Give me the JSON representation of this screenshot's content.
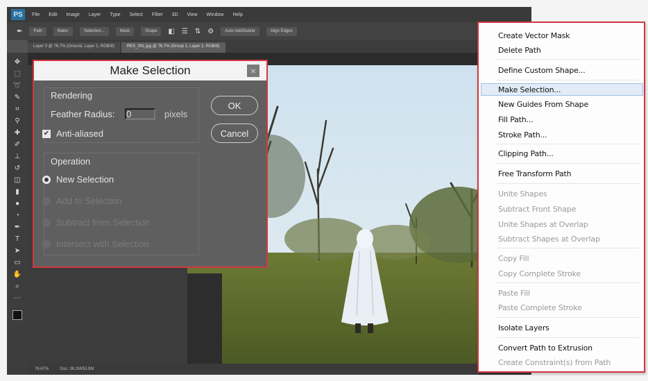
{
  "app": {
    "logo": "PS",
    "menus": [
      "File",
      "Edit",
      "Image",
      "Layer",
      "Type",
      "Select",
      "Filter",
      "3D",
      "View",
      "Window",
      "Help"
    ],
    "options": [
      "Path",
      "Make:",
      "Selection...",
      "Mask",
      "Shape",
      "Auto Add/Delete",
      "Align Edges"
    ],
    "tabs": [
      "Layer 0 @ 76.7% (Ground, Layer 1, RGB/8)",
      "RES_001.jpg @ 76.7% (Group 1, Layer 2, RGB/8)"
    ],
    "status": [
      "76.67%",
      "Doc: 36.2M/53.9M"
    ]
  },
  "dialog": {
    "title": "Make Selection",
    "close": "×",
    "rendering_label": "Rendering",
    "feather_label": "Feather Radius:",
    "feather_value": "0",
    "feather_unit": "pixels",
    "antialias_label": "Anti-aliased",
    "antialias_checked": true,
    "operation_label": "Operation",
    "operations": [
      {
        "label": "New Selection",
        "selected": true,
        "enabled": true
      },
      {
        "label": "Add to Selection",
        "selected": false,
        "enabled": false
      },
      {
        "label": "Subtract from Selection",
        "selected": false,
        "enabled": false
      },
      {
        "label": "Intersect with Selection",
        "selected": false,
        "enabled": false
      }
    ],
    "ok_label": "OK",
    "cancel_label": "Cancel"
  },
  "context_menu": {
    "highlighted": "Make Selection...",
    "items": [
      {
        "label": "Create Vector Mask",
        "enabled": true
      },
      {
        "label": "Delete Path",
        "enabled": true
      },
      {
        "label": "Define Custom Shape...",
        "enabled": true
      },
      {
        "label": "Make Selection...",
        "enabled": true
      },
      {
        "label": "New Guides From Shape",
        "enabled": true
      },
      {
        "label": "Fill Path...",
        "enabled": true
      },
      {
        "label": "Stroke Path...",
        "enabled": true
      },
      {
        "label": "Clipping Path...",
        "enabled": true
      },
      {
        "label": "Free Transform Path",
        "enabled": true
      },
      {
        "label": "Unite Shapes",
        "enabled": false
      },
      {
        "label": "Subtract Front Shape",
        "enabled": false
      },
      {
        "label": "Unite Shapes at Overlap",
        "enabled": false
      },
      {
        "label": "Subtract Shapes at Overlap",
        "enabled": false
      },
      {
        "label": "Copy Fill",
        "enabled": false
      },
      {
        "label": "Copy Complete Stroke",
        "enabled": false
      },
      {
        "label": "Paste Fill",
        "enabled": false
      },
      {
        "label": "Paste Complete Stroke",
        "enabled": false
      },
      {
        "label": "Isolate Layers",
        "enabled": true
      },
      {
        "label": "Convert Path to Extrusion",
        "enabled": true
      },
      {
        "label": "Create Constraint(s) from Path",
        "enabled": false
      }
    ]
  },
  "colors": {
    "highlight_border": "#d4373f",
    "dialog_bg": "#5f5f5f",
    "menu_hover": "#e2ecf7"
  }
}
